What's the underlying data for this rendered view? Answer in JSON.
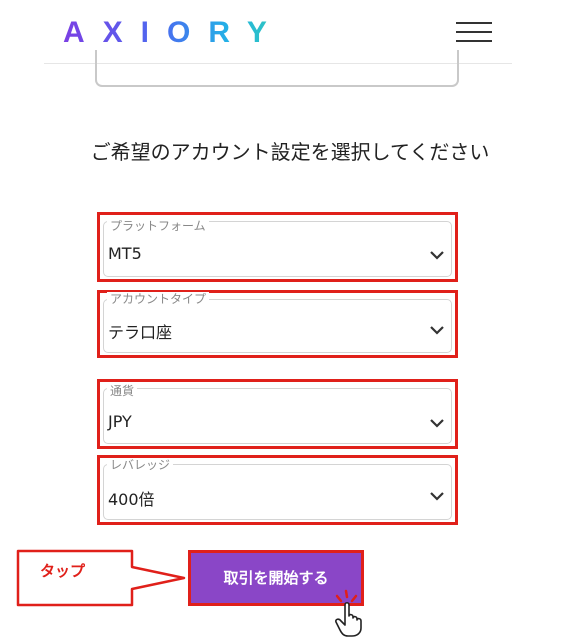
{
  "header": {
    "logo_text": "AXIORY",
    "menu_icon": "hamburger-menu-icon"
  },
  "heading": "ご希望のアカウント設定を選択してください",
  "fields": [
    {
      "label": "プラットフォーム",
      "value": "MT5"
    },
    {
      "label": "アカウントタイプ",
      "value": "テラ口座"
    },
    {
      "label": "通貨",
      "value": "JPY"
    },
    {
      "label": "レバレッジ",
      "value": "400倍"
    }
  ],
  "submit": {
    "label": "取引を開始する"
  },
  "annotation": {
    "callout_text": "タップ"
  },
  "colors": {
    "highlight": "#e0201a",
    "button": "#8a46c7"
  }
}
